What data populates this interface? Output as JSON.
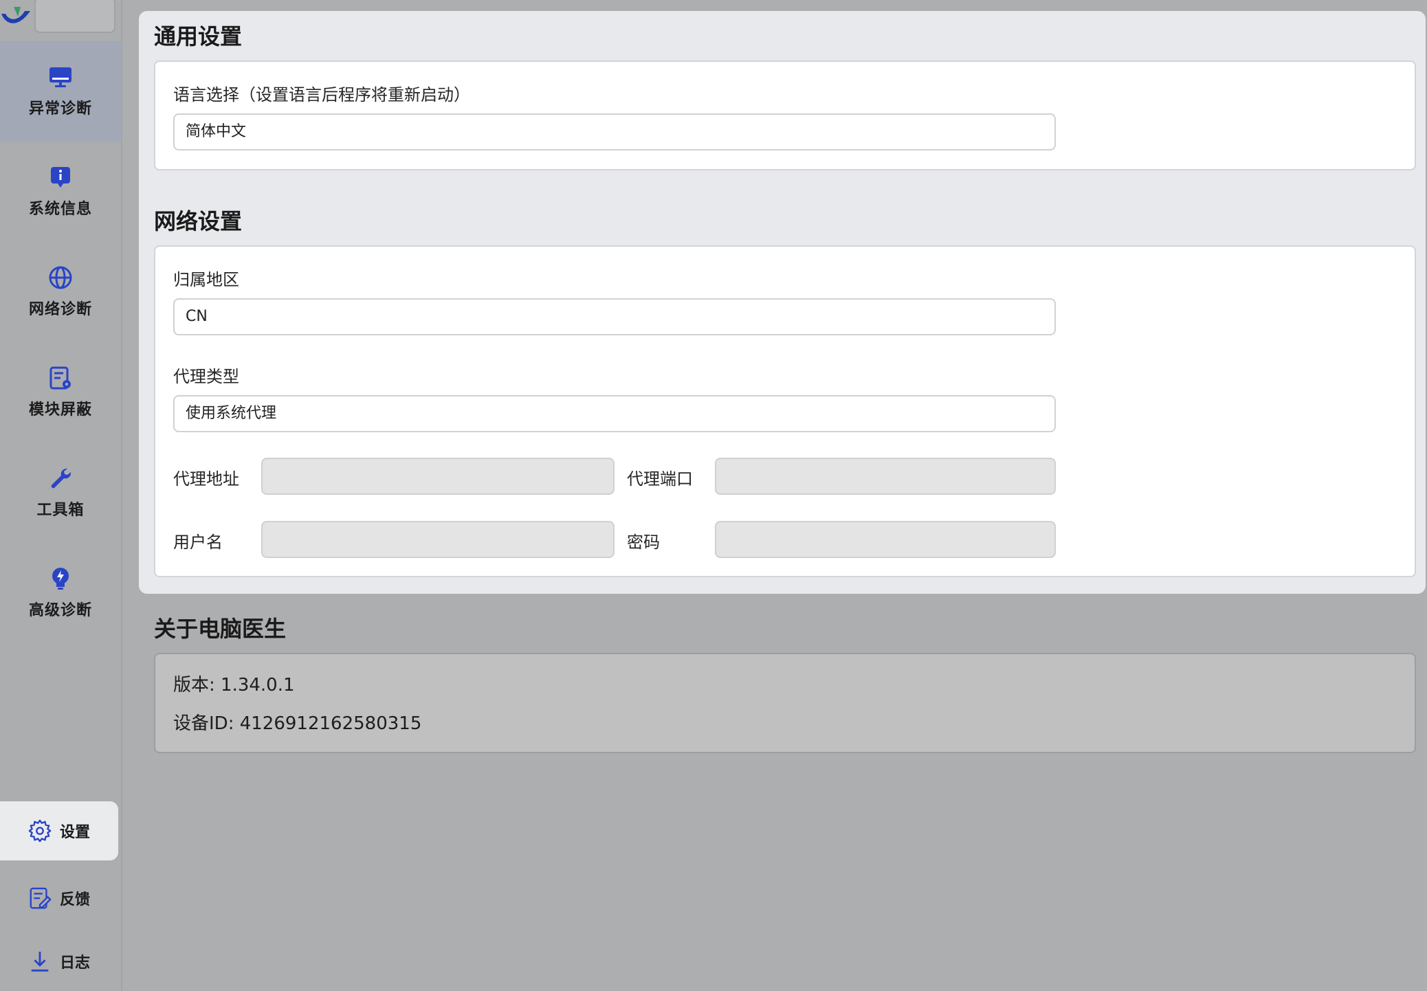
{
  "sidebar": {
    "nav": [
      {
        "label": "异常诊断",
        "icon": "monitor-icon",
        "active": true
      },
      {
        "label": "系统信息",
        "icon": "info-icon",
        "active": false
      },
      {
        "label": "网络诊断",
        "icon": "globe-icon",
        "active": false
      },
      {
        "label": "模块屏蔽",
        "icon": "module-settings-icon",
        "active": false
      },
      {
        "label": "工具箱",
        "icon": "wrench-icon",
        "active": false
      },
      {
        "label": "高级诊断",
        "icon": "lightbulb-bolt-icon",
        "active": false
      }
    ],
    "bottom": [
      {
        "label": "设置",
        "icon": "gear-icon",
        "active": true
      },
      {
        "label": "反馈",
        "icon": "feedback-icon",
        "active": false
      },
      {
        "label": "日志",
        "icon": "download-icon",
        "active": false
      }
    ],
    "accent_color": "#2a44c6"
  },
  "general": {
    "title": "通用设置",
    "language_label": "语言选择（设置语言后程序将重新启动）",
    "language_value": "简体中文"
  },
  "network": {
    "title": "网络设置",
    "region_label": "归属地区",
    "region_value": "CN",
    "proxy_type_label": "代理类型",
    "proxy_type_value": "使用系统代理",
    "proxy_address_label": "代理地址",
    "proxy_address_value": "",
    "proxy_port_label": "代理端口",
    "proxy_port_value": "",
    "username_label": "用户名",
    "username_value": "",
    "password_label": "密码",
    "password_value": ""
  },
  "about": {
    "title": "关于电脑医生",
    "version": "版本: 1.34.0.1",
    "device_id": "设备ID: 4126912162580315"
  }
}
